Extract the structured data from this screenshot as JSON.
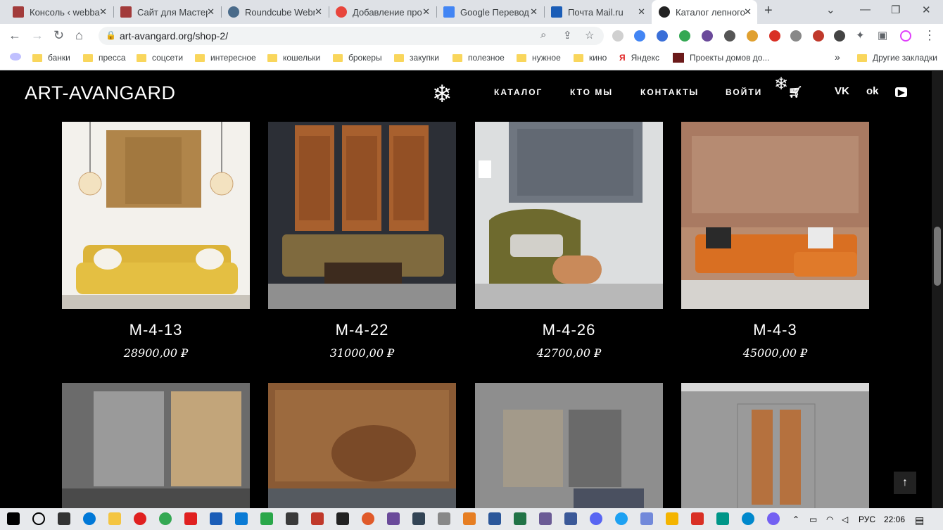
{
  "browser": {
    "tabs": [
      {
        "title": "Консоль ‹ webba",
        "color": "#a23b3b"
      },
      {
        "title": "Сайт для Мастер",
        "color": "#a23b3b"
      },
      {
        "title": "Roundcube Webr",
        "color": "#4a6b8a"
      },
      {
        "title": "Добавление про",
        "color": "#e8453c"
      },
      {
        "title": "Google Перевод",
        "color": "#4285f4"
      },
      {
        "title": "Почта Mail.ru",
        "color": "#1b5db7"
      },
      {
        "title": "Каталог лепного",
        "color": "#222222"
      }
    ],
    "url": "art-avangard.org/shop-2/",
    "bookmarks": [
      "банки",
      "пресса",
      "соцсети",
      "интересное",
      "кошельки",
      "брокеры",
      "закупки",
      "полезное",
      "нужное",
      "кино"
    ],
    "bookmark_yandex": "Яндекс",
    "bookmark_projects": "Проекты домов до...",
    "bookmark_other": "Другие закладки",
    "overflow": "»"
  },
  "site": {
    "logo": "ART-AVANGARD",
    "menu": [
      "КАТАЛОГ",
      "КТО МЫ",
      "КОНТАКТЫ",
      "ВОЙТИ"
    ],
    "social": {
      "vk": "VK",
      "ok": "ok",
      "yt": "▶"
    }
  },
  "products": [
    {
      "title": "M-4-13",
      "price": "28900,00 ₽"
    },
    {
      "title": "M-4-22",
      "price": "31000,00 ₽"
    },
    {
      "title": "M-4-26",
      "price": "42700,00 ₽"
    },
    {
      "title": "M-4-3",
      "price": "45000,00 ₽"
    }
  ],
  "taskbar": {
    "lang": "РУС",
    "time": "22:06"
  }
}
